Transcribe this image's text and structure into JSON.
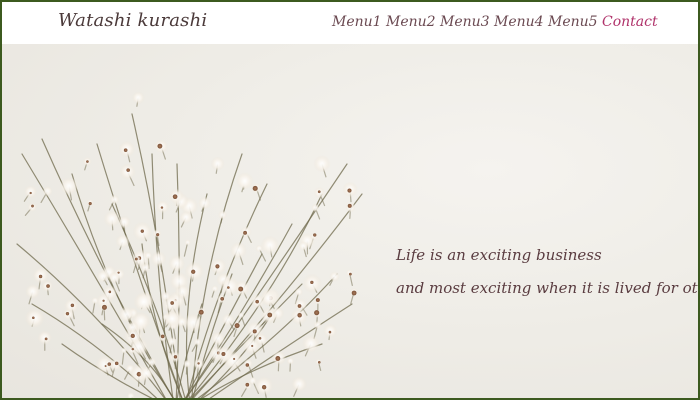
{
  "header": {
    "logo": "Watashi kurashi",
    "nav": [
      {
        "label": "Menu1"
      },
      {
        "label": "Menu2"
      },
      {
        "label": "Menu3"
      },
      {
        "label": "Menu4"
      },
      {
        "label": "Menu5"
      },
      {
        "label": "Contact"
      }
    ]
  },
  "hero": {
    "quote_line1": "Life is an exciting business",
    "quote_line2": "and most exciting when it is lived for others.",
    "image": "dried-flower-bouquet"
  },
  "colors": {
    "frame_border": "#3c5a1f",
    "header_bg": "#ffffff",
    "nav_text": "#6b4a52",
    "contact_text": "#b0336b",
    "quote_text": "#5a3c40",
    "hero_bg": "#efede7"
  }
}
